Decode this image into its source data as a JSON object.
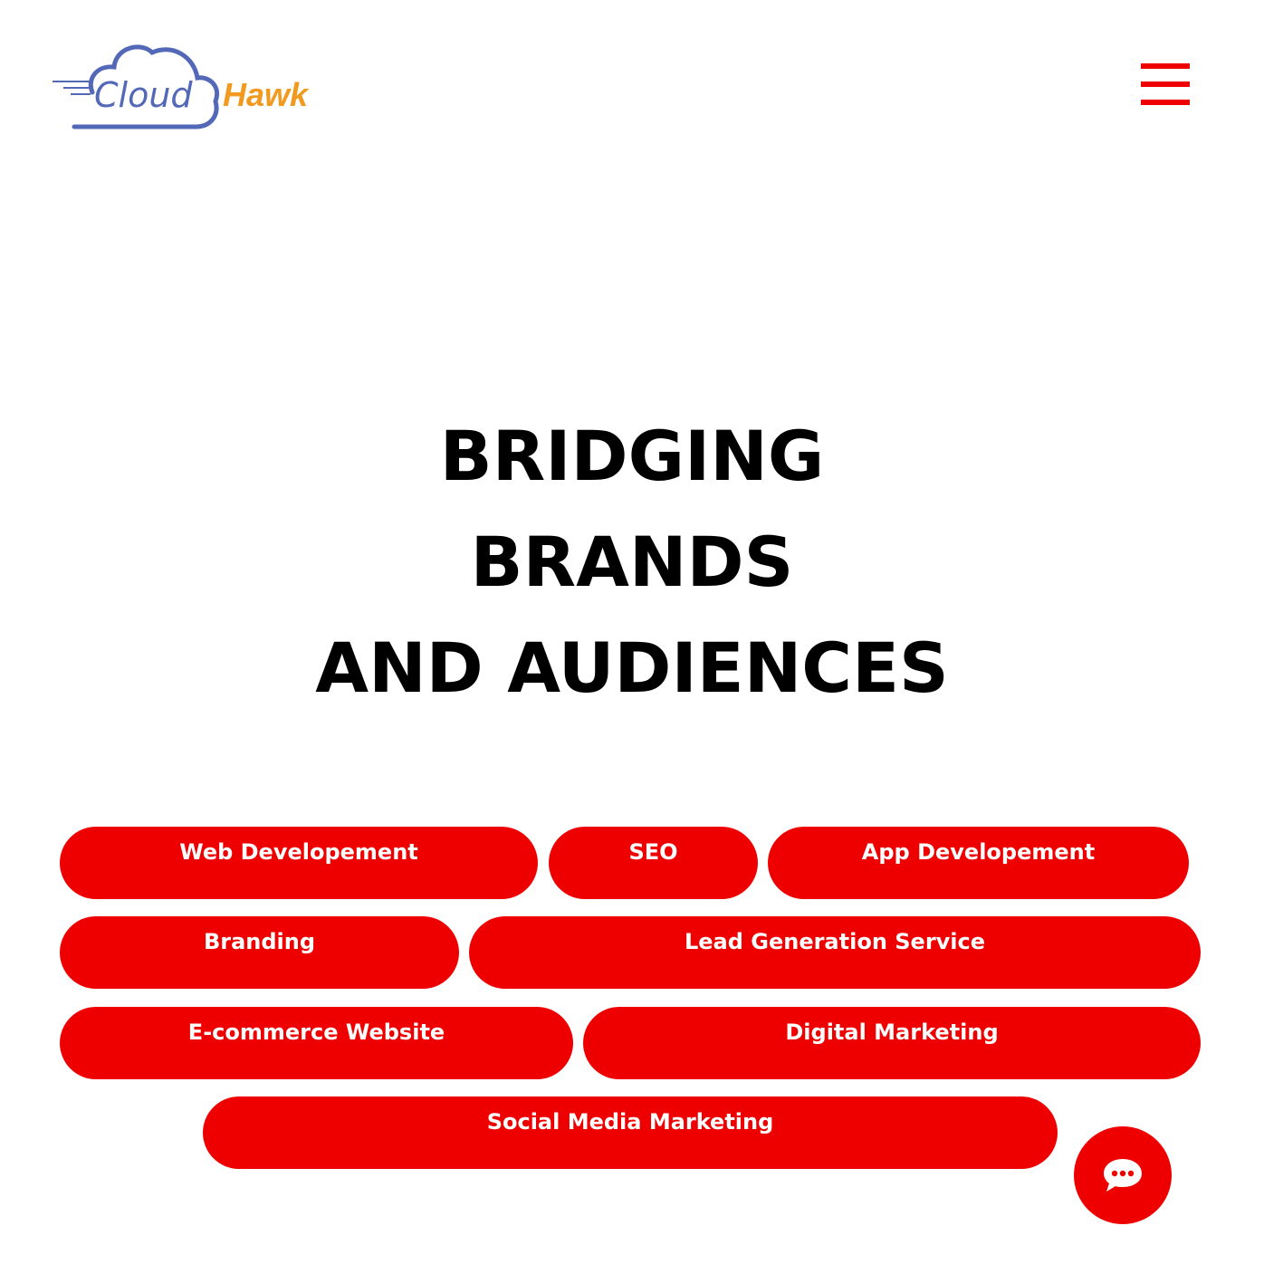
{
  "brand": {
    "logo_text_1": "Cloud",
    "logo_text_2": "Hawk",
    "logo_color_primary": "#5468b8",
    "logo_color_secondary": "#f29a1f"
  },
  "header": {
    "menu_icon": "hamburger-menu-icon",
    "accent_color": "#ee0000"
  },
  "hero": {
    "line_1": "BRIDGING",
    "line_2": "BRANDS",
    "line_3": "AND AUDIENCES"
  },
  "services": [
    {
      "label": "Web Developement"
    },
    {
      "label": "SEO"
    },
    {
      "label": "App Developement"
    },
    {
      "label": "Branding"
    },
    {
      "label": "Lead Generation Service"
    },
    {
      "label": "E-commerce Website"
    },
    {
      "label": "Digital Marketing"
    },
    {
      "label": "Social Media Marketing"
    }
  ],
  "chat": {
    "icon": "chat-bubble-icon"
  }
}
